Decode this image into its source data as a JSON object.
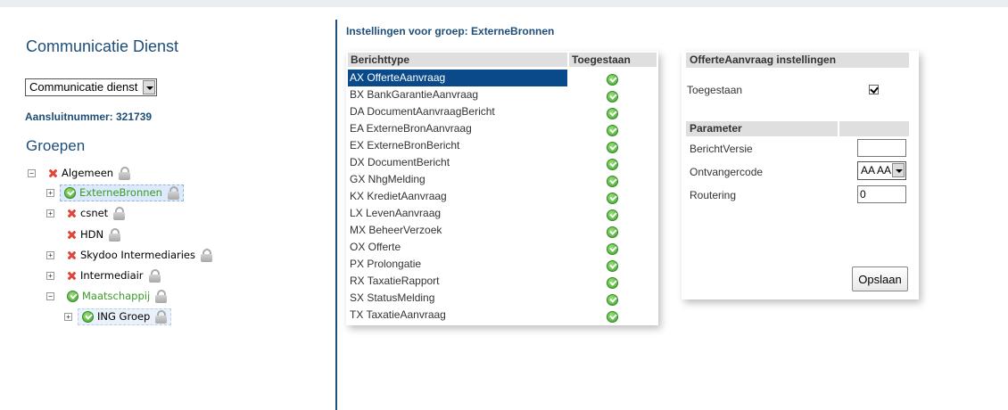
{
  "app": {
    "title": "Communicatie Dienst"
  },
  "dienst_select": {
    "value": "Communicatie dienst"
  },
  "aansluitnummer": "Aansluitnummer: 321739",
  "groepen_title": "Groepen",
  "tree": [
    {
      "label": "Algemeen",
      "status": "x",
      "expander": "minus",
      "locked": true
    },
    {
      "label": "ExterneBronnen",
      "status": "ok",
      "expander": "plus",
      "locked": true,
      "selected": true
    },
    {
      "label": "csnet",
      "status": "x",
      "expander": "plus",
      "locked": true
    },
    {
      "label": "HDN",
      "status": "x",
      "expander": "none",
      "locked": true
    },
    {
      "label": "Skydoo Intermediaries",
      "status": "x",
      "expander": "plus",
      "locked": true
    },
    {
      "label": "Intermediair",
      "status": "x",
      "expander": "plus",
      "locked": true
    },
    {
      "label": "Maatschappij",
      "status": "ok",
      "expander": "minus",
      "locked": true
    },
    {
      "label": "ING Groep",
      "status": "ok",
      "expander": "plus",
      "locked": true
    }
  ],
  "group_heading": "Instellingen voor groep: ExterneBronnen",
  "msg_table": {
    "col_type": "Berichttype",
    "col_allowed": "Toegestaan",
    "rows": [
      "AX OfferteAanvraag",
      "BX BankGarantieAanvraag",
      "DA DocumentAanvraagBericht",
      "EA ExterneBronAanvraag",
      "EX ExterneBronBericht",
      "DX DocumentBericht",
      "GX NhgMelding",
      "KX KredietAanvraag",
      "LX LevenAanvraag",
      "MX BeheerVerzoek",
      "OX Offerte",
      "PX Prolongatie",
      "RX TaxatieRapport",
      "SX StatusMelding",
      "TX TaxatieAanvraag"
    ]
  },
  "settings": {
    "title": "OfferteAanvraag instellingen",
    "toegestaan_label": "Toegestaan",
    "toegestaan_checked": true,
    "param_header": "Parameter",
    "berichtversie_label": "BerichtVersie",
    "berichtversie_value": "",
    "ontvangercode_label": "Ontvangercode",
    "ontvangercode_value": "AA  AA",
    "routering_label": "Routering",
    "routering_value": "0",
    "save_label": "Opslaan"
  },
  "colors": {
    "accent": "#1e4e79",
    "selected_row": "#0a4a8a",
    "ok_green": "#3fa72b",
    "error_red": "#e0443a"
  }
}
